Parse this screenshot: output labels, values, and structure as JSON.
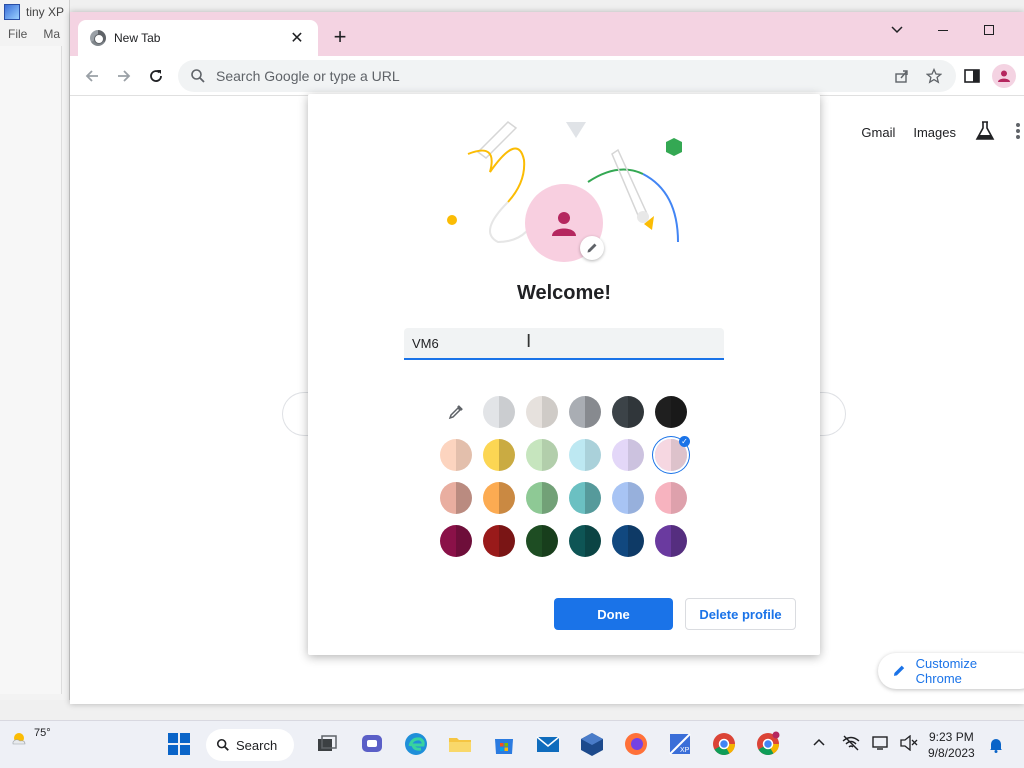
{
  "bg_app": {
    "title": "tiny XP",
    "menu": [
      "File",
      "Ma"
    ]
  },
  "browser": {
    "tab_title": "New Tab",
    "omnibox_placeholder": "Search Google or type a URL",
    "links": {
      "gmail": "Gmail",
      "images": "Images"
    },
    "customize_label": "Customize Chrome"
  },
  "dialog": {
    "title": "Welcome!",
    "name_value": "VM6",
    "done_label": "Done",
    "delete_label": "Delete profile",
    "selected_color": "pink",
    "swatches": [
      [
        "#ffffff",
        "#e2e4e7",
        "#e6e1dd",
        "#a9adb3",
        "#3c4348",
        "#1f1f1f"
      ],
      [
        "#fcd4bf",
        "#fcd653",
        "#c6e5be",
        "#bde8f2",
        "#e3d7f8",
        "#f6d7e1"
      ],
      [
        "#e9aea0",
        "#fcab52",
        "#8ec995",
        "#6bc0c2",
        "#a8c4f4",
        "#f7b3bf"
      ],
      [
        "#8a1148",
        "#991a1a",
        "#1e4d23",
        "#0e5555",
        "#11487f",
        "#6a3a9f"
      ]
    ]
  },
  "taskbar": {
    "temperature": "75°",
    "search_label": "Search",
    "time": "9:23 PM",
    "date": "9/8/2023"
  }
}
